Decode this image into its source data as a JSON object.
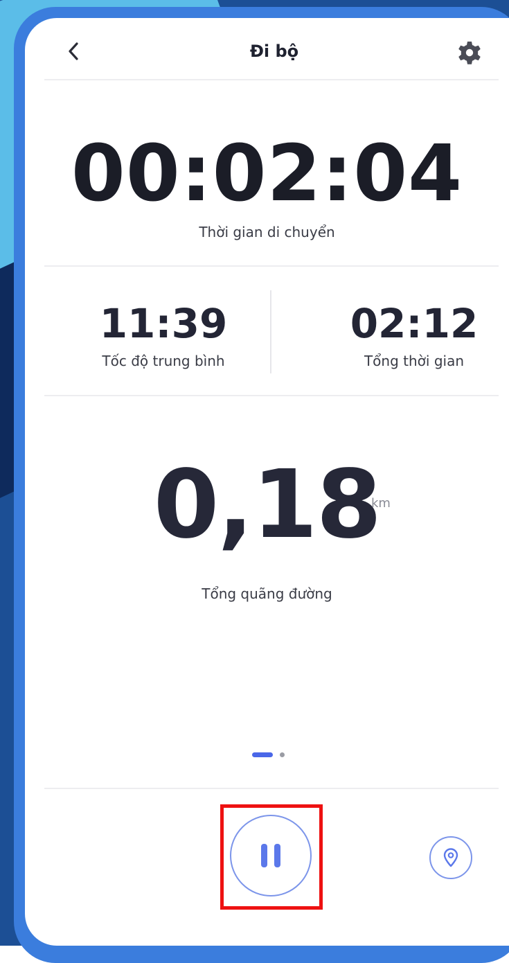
{
  "header": {
    "title": "Đi bộ",
    "back_icon": "chevron-left-icon",
    "settings_icon": "gear-icon"
  },
  "timer": {
    "value": "00:02:04",
    "label": "Thời gian di chuyển"
  },
  "stats": {
    "avg_speed": {
      "value": "11:39",
      "label": "Tốc độ trung bình"
    },
    "total_time": {
      "value": "02:12",
      "label": "Tổng thời gian"
    }
  },
  "distance": {
    "value": "0,18",
    "unit": "km",
    "label": "Tổng quãng đường"
  },
  "pager": {
    "current_page": 1,
    "page_count": 2
  },
  "controls": {
    "pause_icon": "pause-icon",
    "location_icon": "location-pin-icon"
  },
  "colors": {
    "accent": "#4a67e8",
    "button_border": "#7c95ea",
    "highlight": "#ee1111",
    "text_dark": "#1b1d27"
  }
}
